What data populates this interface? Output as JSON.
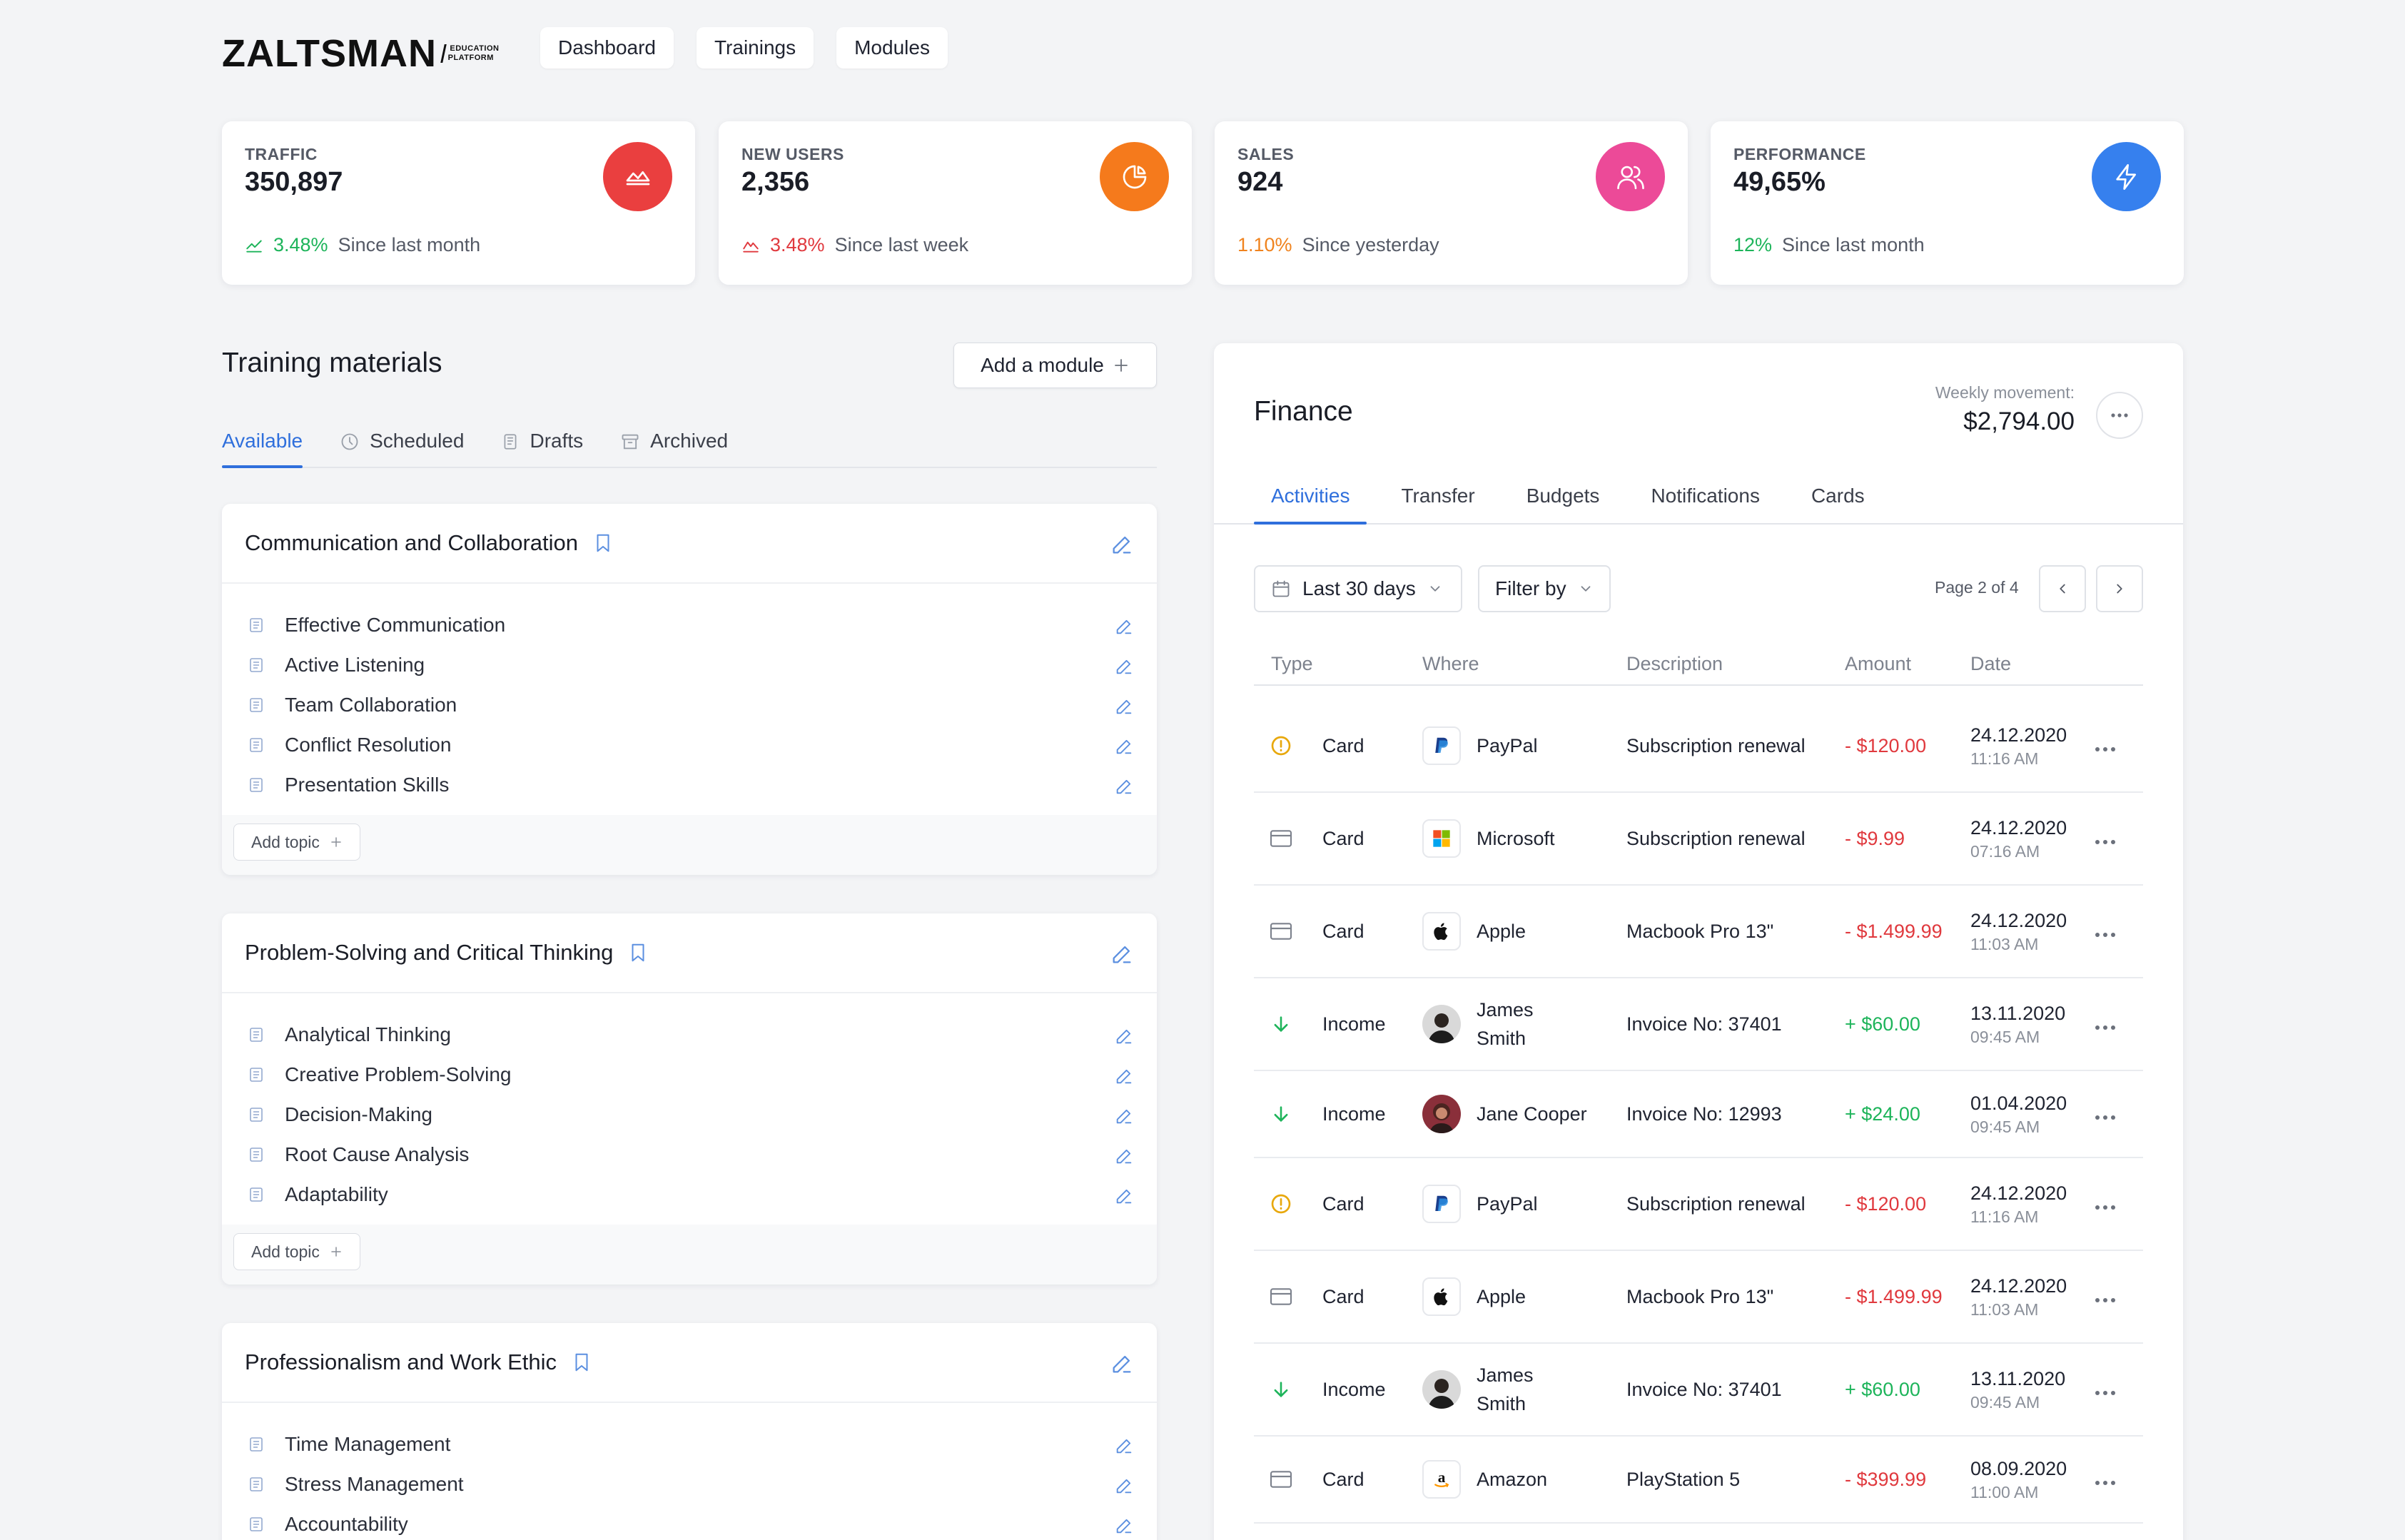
{
  "header": {
    "logo": {
      "word": "ZALTSMAN",
      "sub_line1": "EDUCATION",
      "sub_line2": "PLATFORM"
    },
    "nav": [
      "Dashboard",
      "Trainings",
      "Modules"
    ]
  },
  "stats": [
    {
      "label": "TRAFFIC",
      "value": "350,897",
      "change": "3.48%",
      "period": "Since last month",
      "change_color": "#1db45a",
      "circle_color": "#ea3f3f",
      "icon": "area-chart-icon",
      "trend_icon": "trend-up-icon"
    },
    {
      "label": "NEW USERS",
      "value": "2,356",
      "change": "3.48%",
      "period": "Since last week",
      "change_color": "#e0393e",
      "circle_color": "#f57a1c",
      "icon": "pie-chart-icon",
      "trend_icon": "trend-down-icon"
    },
    {
      "label": "SALES",
      "value": "924",
      "change": "1.10%",
      "period": "Since yesterday",
      "change_color": "#f0831e",
      "circle_color": "#ec4a98",
      "icon": "users-icon",
      "trend_icon": ""
    },
    {
      "label": "PERFORMANCE",
      "value": "49,65%",
      "change": "12%",
      "period": "Since last month",
      "change_color": "#1db45a",
      "circle_color": "#3680ee",
      "icon": "lightning-icon",
      "trend_icon": ""
    }
  ],
  "training": {
    "title": "Training materials",
    "add_module": "Add a module",
    "tabs": [
      {
        "label": "Available",
        "icon": "",
        "active": true
      },
      {
        "label": "Scheduled",
        "icon": "clock-icon",
        "active": false
      },
      {
        "label": "Drafts",
        "icon": "drafts-icon",
        "active": false
      },
      {
        "label": "Archived",
        "icon": "archive-icon",
        "active": false
      }
    ],
    "add_topic": "Add topic",
    "modules": [
      {
        "title": "Communication and Collaboration",
        "topics": [
          "Effective Communication",
          "Active Listening",
          "Team Collaboration",
          "Conflict Resolution",
          "Presentation Skills"
        ]
      },
      {
        "title": "Problem-Solving and Critical Thinking",
        "topics": [
          "Analytical Thinking",
          "Creative Problem-Solving",
          "Decision-Making",
          "Root Cause Analysis",
          "Adaptability"
        ]
      },
      {
        "title": "Professionalism and Work Ethic",
        "topics": [
          "Time Management",
          "Stress Management",
          "Accountability"
        ]
      }
    ]
  },
  "finance": {
    "title": "Finance",
    "weekly_label": "Weekly movement:",
    "weekly_value": "$2,794.00",
    "tabs": [
      "Activities",
      "Transfer",
      "Budgets",
      "Notifications",
      "Cards"
    ],
    "active_tab": "Activities",
    "range_filter": "Last 30 days",
    "filter_by": "Filter by",
    "page_info": "Page 2 of 4",
    "columns": [
      "Type",
      "Where",
      "Description",
      "Amount",
      "Date"
    ],
    "rows": [
      {
        "type": "Card",
        "type_icon": "warning-icon",
        "where": "PayPal",
        "where_icon": "paypal-icon",
        "description": "Subscription renewal",
        "amount": "- $120.00",
        "sign": "neg",
        "date": "24.12.2020",
        "time": "11:16 AM"
      },
      {
        "type": "Card",
        "type_icon": "card-icon",
        "where": "Microsoft",
        "where_icon": "microsoft-icon",
        "description": "Subscription renewal",
        "amount": "- $9.99",
        "sign": "neg",
        "date": "24.12.2020",
        "time": "07:16 AM"
      },
      {
        "type": "Card",
        "type_icon": "card-icon",
        "where": "Apple",
        "where_icon": "apple-icon",
        "description": "Macbook Pro 13\"",
        "amount": "- $1.499.99",
        "sign": "neg",
        "date": "24.12.2020",
        "time": "11:03 AM"
      },
      {
        "type": "Income",
        "type_icon": "arrow-down-icon",
        "where": "James Smith",
        "where_icon": "avatar-james",
        "description": "Invoice No: 37401",
        "amount": "+ $60.00",
        "sign": "pos",
        "date": "13.11.2020",
        "time": "09:45 AM"
      },
      {
        "type": "Income",
        "type_icon": "arrow-down-icon",
        "where": "Jane Cooper",
        "where_icon": "avatar-jane",
        "description": "Invoice No: 12993",
        "amount": "+ $24.00",
        "sign": "pos",
        "date": "01.04.2020",
        "time": "09:45 AM"
      },
      {
        "type": "Card",
        "type_icon": "warning-icon",
        "where": "PayPal",
        "where_icon": "paypal-icon",
        "description": "Subscription renewal",
        "amount": "- $120.00",
        "sign": "neg",
        "date": "24.12.2020",
        "time": "11:16 AM"
      },
      {
        "type": "Card",
        "type_icon": "card-icon",
        "where": "Apple",
        "where_icon": "apple-icon",
        "description": "Macbook Pro 13\"",
        "amount": "- $1.499.99",
        "sign": "neg",
        "date": "24.12.2020",
        "time": "11:03 AM"
      },
      {
        "type": "Income",
        "type_icon": "arrow-down-icon",
        "where": "James Smith",
        "where_icon": "avatar-james",
        "description": "Invoice No: 37401",
        "amount": "+ $60.00",
        "sign": "pos",
        "date": "13.11.2020",
        "time": "09:45 AM"
      },
      {
        "type": "Card",
        "type_icon": "card-icon",
        "where": "Amazon",
        "where_icon": "amazon-icon",
        "description": "PlayStation 5",
        "amount": "- $399.99",
        "sign": "neg",
        "date": "08.09.2020",
        "time": "11:00 AM"
      }
    ]
  },
  "colors": {
    "accent": "#2f6fdc",
    "positive": "#1db45a",
    "negative": "#e0393e",
    "warning": "#e8a80c"
  }
}
